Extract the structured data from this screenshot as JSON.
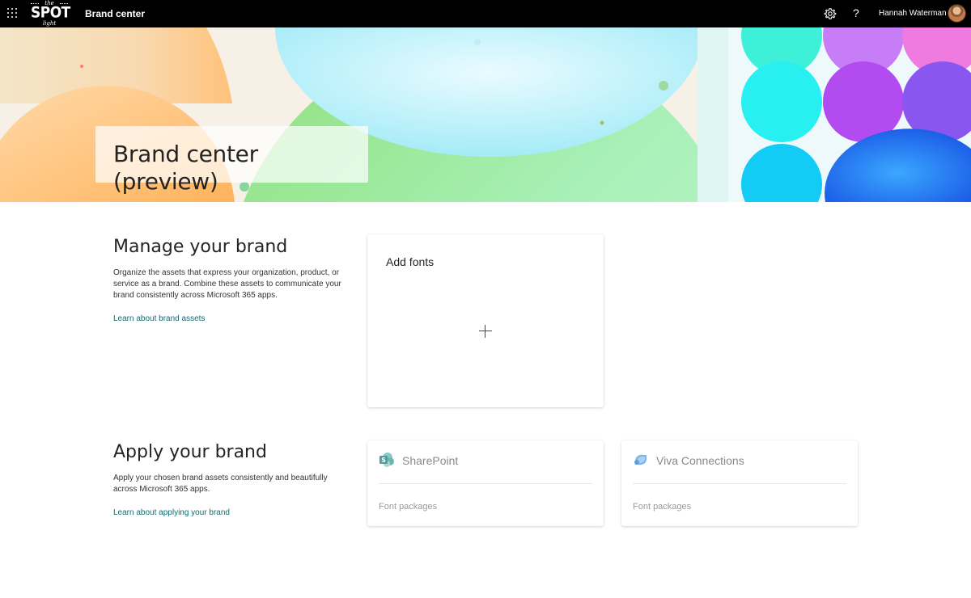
{
  "topbar": {
    "logo": {
      "top_text": "the",
      "main_text": "SPOT",
      "bottom_text": "light"
    },
    "app_title": "Brand center",
    "icons": [
      "app-launcher-icon",
      "settings-gear-icon",
      "help-icon"
    ],
    "help_glyph": "?",
    "user_name": "Hannah Waterman"
  },
  "banner": {
    "title": "Brand center (preview)"
  },
  "manage": {
    "title": "Manage your brand",
    "description": "Organize the assets that express your organization, product, or service as a brand. Combine these assets to communicate your brand consistently across Microsoft 365 apps.",
    "link": "Learn about brand assets",
    "card": {
      "title": "Add fonts",
      "action_icon": "plus-icon"
    }
  },
  "apply": {
    "title": "Apply your brand",
    "description": "Apply your chosen brand assets consistently and beautifully across Microsoft 365 apps.",
    "link": "Learn about applying your brand",
    "apps": [
      {
        "name": "SharePoint",
        "icon": "sharepoint-icon",
        "subtitle": "Font packages"
      },
      {
        "name": "Viva Connections",
        "icon": "viva-connections-icon",
        "subtitle": "Font packages"
      }
    ]
  },
  "colors": {
    "topbar_bg": "#000000",
    "link": "#0f6a73",
    "banner_orange": "#ffc27a",
    "banner_green": "#a8f0b8",
    "banner_cyan": "#2ee6f0",
    "banner_purple": "#b34cf0",
    "banner_blue": "#2f7ef0"
  }
}
